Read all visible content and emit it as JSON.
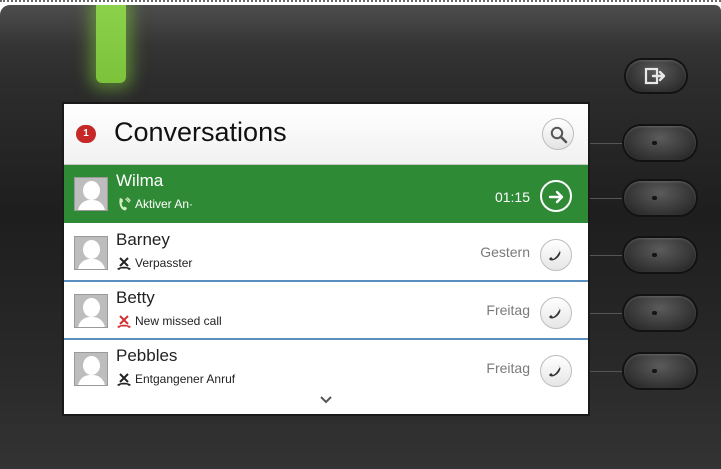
{
  "header": {
    "badge_count": "1",
    "title": "Conversations",
    "search_icon": "search-icon"
  },
  "conversations": [
    {
      "name": "Wilma",
      "status": "Aktiver An·",
      "time": "01:15",
      "status_icon": "active-call-icon",
      "action_icon": "arrow-right-icon",
      "active": true
    },
    {
      "name": "Barney",
      "status": "Verpasster",
      "time": "Gestern",
      "status_icon": "missed-call-icon",
      "action_icon": "phone-icon",
      "active": false
    },
    {
      "name": "Betty",
      "status": "New missed call",
      "time": "Freitag",
      "status_icon": "new-missed-call-icon",
      "action_icon": "phone-icon",
      "active": false
    },
    {
      "name": "Pebbles",
      "status": "Entgangener Anruf",
      "time": "Freitag",
      "status_icon": "missed-call-icon",
      "action_icon": "phone-icon",
      "active": false
    }
  ],
  "colors": {
    "active_row": "#2f8a35",
    "led": "#7cc23b",
    "badge": "#c62828",
    "missed_new": "#d32f2f",
    "row_divider": "#5b8fbf"
  },
  "hardware": {
    "exit_icon": "exit-icon",
    "scroll_icon": "chevron-down-icon"
  }
}
